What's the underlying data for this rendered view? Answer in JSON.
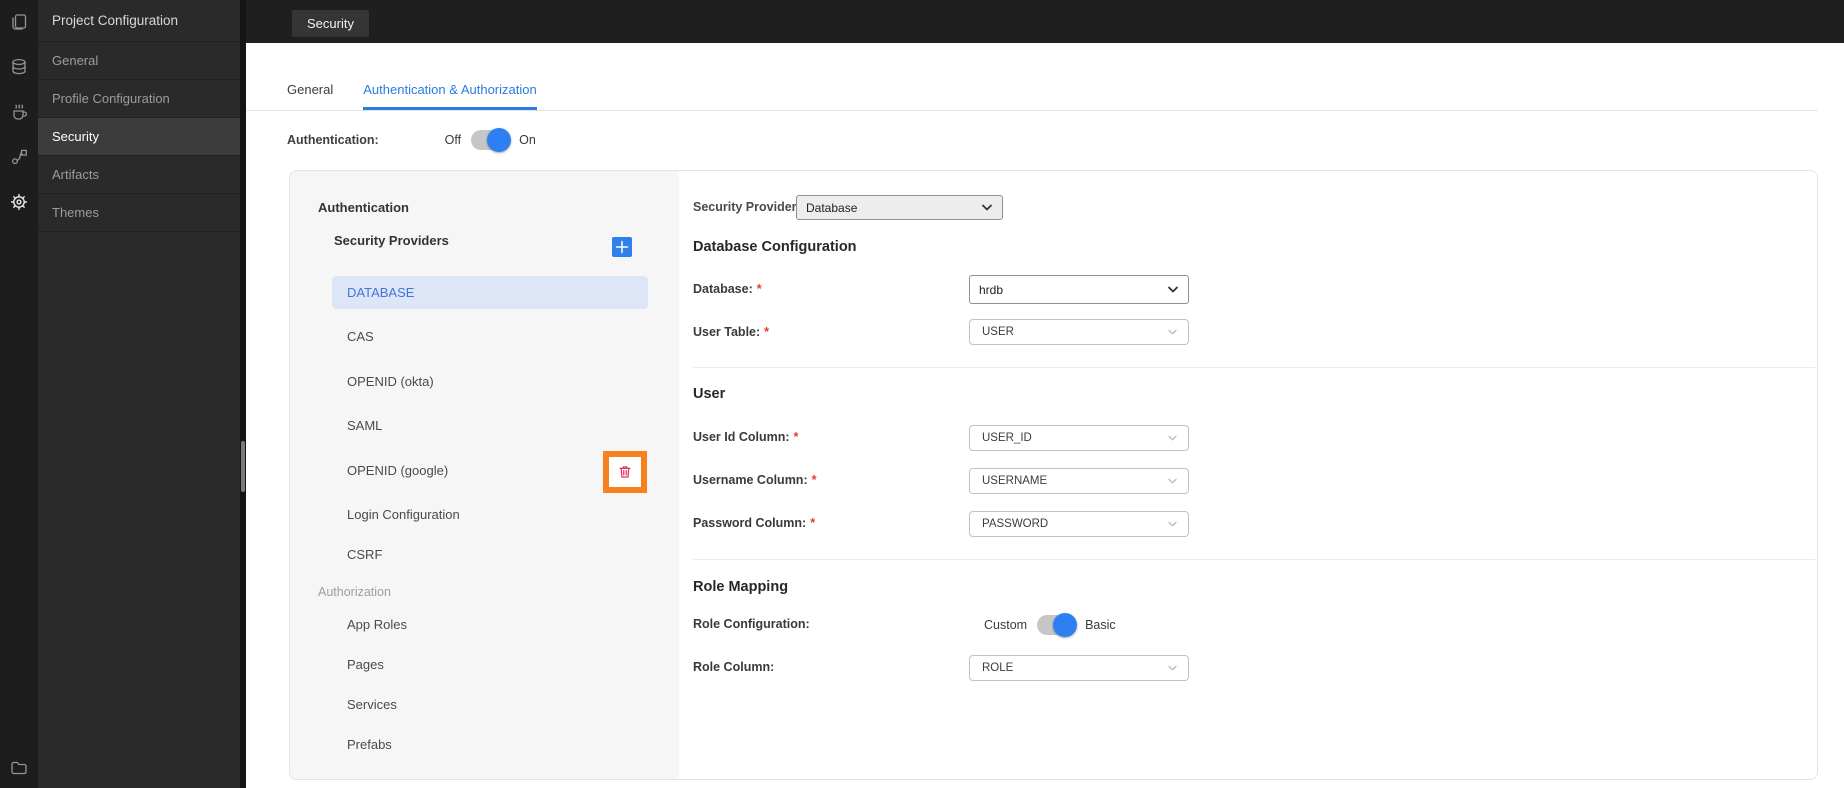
{
  "window": {
    "topbar_tab": "Security"
  },
  "icon_rail": {
    "icons": [
      "pages-icon",
      "database-icon",
      "java-service-icon",
      "api-flow-icon",
      "settings-gear-icon",
      "folder-icon"
    ]
  },
  "sidebar": {
    "title": "Project Configuration",
    "items": [
      {
        "label": "General",
        "active": false
      },
      {
        "label": "Profile Configuration",
        "active": false
      },
      {
        "label": "Security",
        "active": true
      },
      {
        "label": "Artifacts",
        "active": false
      },
      {
        "label": "Themes",
        "active": false
      }
    ]
  },
  "tabs": {
    "general": "General",
    "auth": "Authentication & Authorization"
  },
  "auth_row": {
    "label": "Authentication:",
    "off": "Off",
    "on": "On",
    "state": "on"
  },
  "panel": {
    "auth_section": "Authentication",
    "providers_title": "Security Providers",
    "providers": [
      {
        "label": "DATABASE",
        "selected": true
      },
      {
        "label": "CAS",
        "selected": false
      },
      {
        "label": "OPENID (okta)",
        "selected": false
      },
      {
        "label": "SAML",
        "selected": false
      },
      {
        "label": "OPENID (google)",
        "selected": false
      }
    ],
    "login_config": "Login Configuration",
    "csrf": "CSRF",
    "authz_section": "Authorization",
    "authz_items": [
      {
        "label": "App Roles"
      },
      {
        "label": "Pages"
      },
      {
        "label": "Services"
      },
      {
        "label": "Prefabs"
      }
    ]
  },
  "form": {
    "required_marker": "*",
    "provider_label": "Security Provider",
    "provider_value": "Database",
    "db_config_heading": "Database Configuration",
    "database_label": "Database:",
    "database_value": "hrdb",
    "user_table_label": "User Table:",
    "user_table_value": "USER",
    "user_heading": "User",
    "user_id_label": "User Id Column:",
    "user_id_value": "USER_ID",
    "username_label": "Username Column:",
    "username_value": "USERNAME",
    "password_label": "Password Column:",
    "password_value": "PASSWORD",
    "role_heading": "Role Mapping",
    "role_config_label": "Role Configuration:",
    "role_custom": "Custom",
    "role_basic": "Basic",
    "role_toggle_state": "basic",
    "role_column_label": "Role Column:",
    "role_column_value": "ROLE"
  },
  "colors": {
    "accent_blue": "#2f80ed",
    "tab_blue": "#2b7ce0",
    "toggle_blue": "#2d7ff2",
    "selected_item_bg": "#dce6f7",
    "selected_item_text": "#4176d9",
    "highlight_orange": "#f5821f",
    "trash_red": "#e8335e",
    "required_red": "#e53935"
  }
}
